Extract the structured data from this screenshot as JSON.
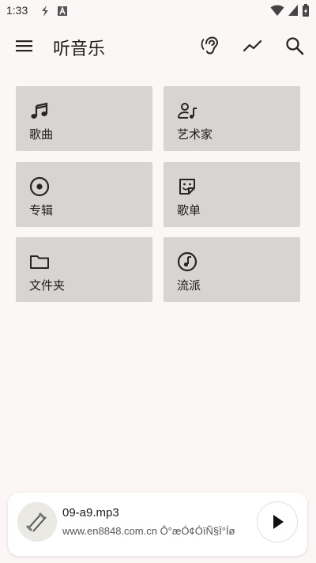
{
  "status_bar": {
    "time": "1:33"
  },
  "app_bar": {
    "title": "听音乐"
  },
  "tiles": [
    {
      "label": "歌曲",
      "icon": "music-note-icon"
    },
    {
      "label": "艺术家",
      "icon": "artist-icon"
    },
    {
      "label": "专辑",
      "icon": "album-icon"
    },
    {
      "label": "歌单",
      "icon": "playlist-icon"
    },
    {
      "label": "文件夹",
      "icon": "folder-icon"
    },
    {
      "label": "流派",
      "icon": "genre-icon"
    }
  ],
  "player": {
    "title": "09-a9.mp3",
    "subtitle": "www.en8848.com.cn Ô°æÓ¢ÓïÑ§Ï°Íø"
  },
  "colors": {
    "background": "#fbf7f6",
    "tile": "#d8d4d3",
    "text": "#1f1b1a"
  }
}
